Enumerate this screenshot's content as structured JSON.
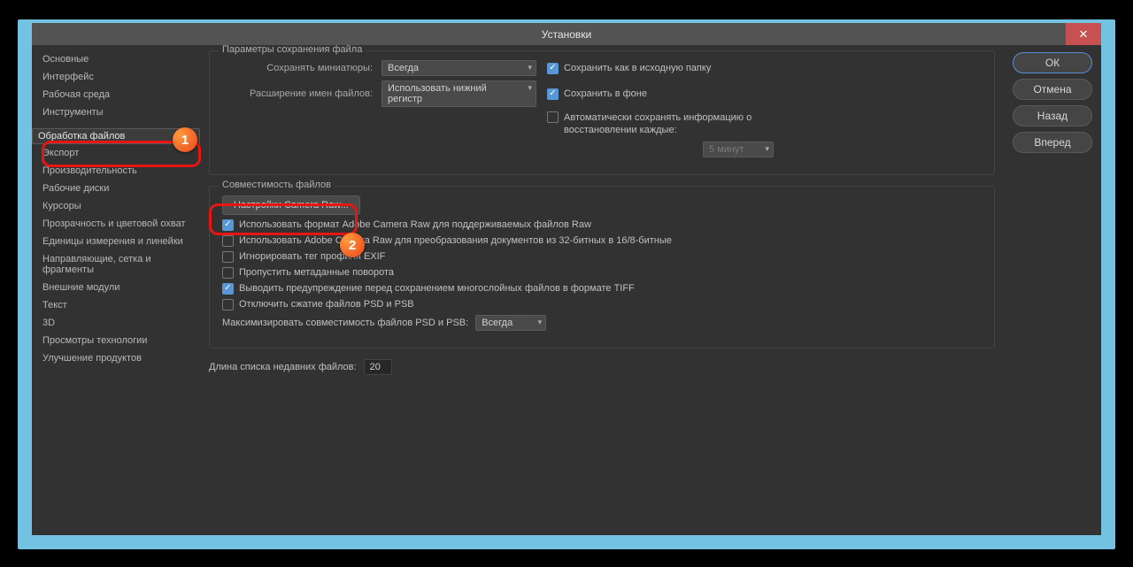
{
  "window": {
    "title": "Установки",
    "close": "✕"
  },
  "sidebar": {
    "items": [
      "Основные",
      "Интерфейс",
      "Рабочая среда",
      "Инструменты",
      "",
      "Обработка файлов",
      "Экспорт",
      "Производительность",
      "Рабочие диски",
      "Курсоры",
      "Прозрачность и цветовой охват",
      "Единицы измерения и линейки",
      "Направляющие, сетка и фрагменты",
      "Внешние модули",
      "Текст",
      "3D",
      "Просмотры технологии",
      "Улучшение продуктов"
    ],
    "selected_index": 5
  },
  "right_buttons": {
    "ok": "ОК",
    "cancel": "Отмена",
    "prev": "Назад",
    "next": "Вперед"
  },
  "save_group": {
    "title": "Параметры сохранения файла",
    "thumb_label": "Сохранять миниатюры:",
    "thumb_value": "Всегда",
    "ext_label": "Расширение имен файлов:",
    "ext_value": "Использовать нижний регистр",
    "save_orig": "Сохранить как в исходную папку",
    "save_bg": "Сохранить в фоне",
    "autosave": "Автоматически сохранять информацию о восстановлении каждые:",
    "autosave_val": "5 минут"
  },
  "compat_group": {
    "title": "Совместимость файлов",
    "camera_raw_btn": "Настройки Camera Raw...",
    "cb1": "Использовать формат Adobe Camera Raw для поддерживаемых файлов Raw",
    "cb2": "Использовать Adobe Camera Raw для преобразования документов из 32-битных в 16/8-битные",
    "cb3": "Игнорировать тег профиля EXIF",
    "cb4": "Пропустить метаданные поворота",
    "cb5": "Выводить предупреждение перед сохранением многослойных файлов в формате TIFF",
    "cb6": "Отключить сжатие файлов PSD и PSB",
    "max_label": "Максимизировать совместимость файлов PSD и PSB:",
    "max_value": "Всегда"
  },
  "recent": {
    "label": "Длина списка недавних файлов:",
    "value": "20"
  },
  "badges": {
    "b1": "1",
    "b2": "2"
  }
}
